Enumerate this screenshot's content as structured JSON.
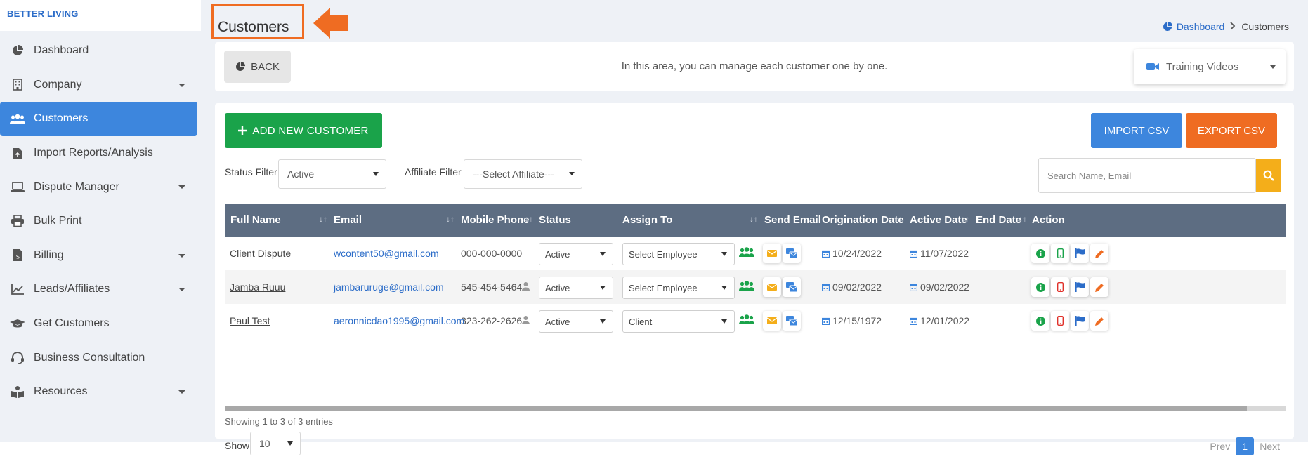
{
  "brand": "BETTER LIVING",
  "nav": [
    {
      "label": "Dashboard",
      "icon": "chart-pie-icon"
    },
    {
      "label": "Company",
      "icon": "building-icon"
    },
    {
      "label": "Customers",
      "icon": "users-icon"
    },
    {
      "label": "Import Reports/Analysis",
      "icon": "file-upload-icon"
    },
    {
      "label": "Dispute Manager",
      "icon": "laptop-icon"
    },
    {
      "label": "Bulk Print",
      "icon": "printer-icon"
    },
    {
      "label": "Billing",
      "icon": "invoice-icon"
    },
    {
      "label": "Leads/Affiliates",
      "icon": "line-chart-icon"
    },
    {
      "label": "Get Customers",
      "icon": "graduation-cap-icon"
    },
    {
      "label": "Business Consultation",
      "icon": "headset-icon"
    },
    {
      "label": "Resources",
      "icon": "book-reader-icon"
    }
  ],
  "page": {
    "title": "Customers",
    "breadcrumb": {
      "home": "Dashboard",
      "current": "Customers"
    },
    "back_label": "BACK",
    "info": "In this area, you can manage each customer one by one.",
    "training_label": "Training Videos"
  },
  "toolbar": {
    "add_label": "ADD NEW CUSTOMER",
    "import_label": "IMPORT CSV",
    "export_label": "EXPORT CSV",
    "status_filter_label": "Status Filter",
    "status_filter_value": "Active",
    "affiliate_filter_label": "Affiliate Filter",
    "affiliate_filter_value": "---Select Affiliate---",
    "search_placeholder": "Search Name, Email"
  },
  "table": {
    "headers": {
      "full_name": "Full Name",
      "email": "Email",
      "mobile": "Mobile Phone",
      "status": "Status",
      "assign": "Assign To",
      "send_email": "Send Email",
      "orig_date": "Origination Date",
      "active_date": "Active Date",
      "end_date": "End Date",
      "action": "Action"
    },
    "rows": [
      {
        "name": "Client Dispute",
        "email": "wcontent50@gmail.com",
        "phone": "000-000-0000",
        "status": "Active",
        "assign": "Select Employee",
        "orig": "10/24/2022",
        "active": "11/07/2022",
        "phone_color": "#1aa34a"
      },
      {
        "name": "Jamba Ruuu",
        "email": "jambaruruge@gmail.com",
        "phone": "545-454-5464",
        "status": "Active",
        "assign": "Select Employee",
        "orig": "09/02/2022",
        "active": "09/02/2022",
        "phone_color": "#e0322b"
      },
      {
        "name": "Paul Test",
        "email": "aeronnicdao1995@gmail.com",
        "phone": "323-262-2626",
        "status": "Active",
        "assign": "Client",
        "orig": "12/15/1972",
        "active": "12/01/2022",
        "phone_color": "#e0322b"
      }
    ]
  },
  "footer": {
    "showing": "Showing 1 to 3 of 3 entries",
    "show_label": "Show",
    "page_size": "10",
    "prev": "Prev",
    "page": "1",
    "next": "Next"
  }
}
